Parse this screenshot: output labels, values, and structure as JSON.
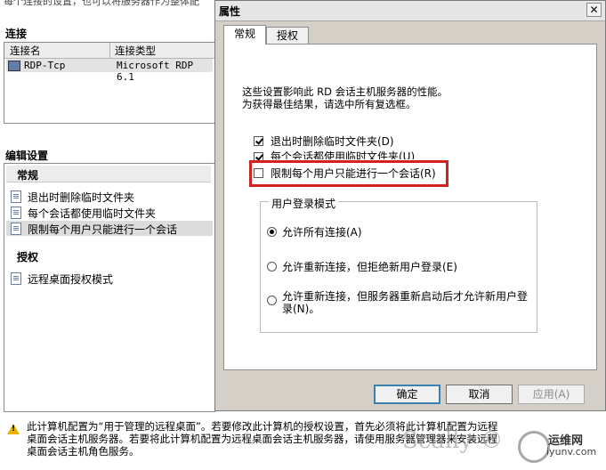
{
  "background": {
    "top_text": "每个连接的设置，也可以将服务器作为整体配",
    "connections_title": "连接",
    "columns": [
      "连接名",
      "连接类型"
    ],
    "rows": [
      {
        "name": "RDP-Tcp",
        "type": "Microsoft RDP 6.1"
      }
    ],
    "edit_title": "编辑设置",
    "groups": [
      {
        "label": "常规",
        "items": [
          "退出时删除临时文件夹",
          "每个会话都使用临时文件夹",
          "限制每个用户只能进行一个会话"
        ]
      },
      {
        "label": "授权",
        "items": [
          "远程桌面授权模式"
        ]
      }
    ],
    "bottom_note": "此计算机配置为“用于管理的远程桌面”。若要修改此计算机的授权设置，首先必须将此计算机配置为远程桌面会话主机服务器。若要将此计算机配置为远程桌面会话主机服务器，请使用服务器管理器来安装远程桌面会话主机角色服务。"
  },
  "dialog": {
    "title": "属性",
    "close_glyph": "✕",
    "tabs": [
      "常规",
      "授权"
    ],
    "description": [
      "这些设置影响此 RD 会话主机服务器的性能。",
      "为获得最佳结果，请选中所有复选框。"
    ],
    "checkboxes": [
      {
        "label": "退出时删除临时文件夹(D)",
        "checked": true
      },
      {
        "label": "每个会话都使用临时文件夹(U)",
        "checked": true
      },
      {
        "label": "限制每个用户只能进行一个会话(R)",
        "checked": false
      }
    ],
    "login_mode": {
      "legend": "用户登录模式",
      "options": [
        {
          "label": "允许所有连接(A)",
          "selected": true
        },
        {
          "label": "允许重新连接，但拒绝新用户登录(E)",
          "selected": false
        },
        {
          "label_line1": "允许重新连接，但服务器重新启动后才允许新用户登",
          "label_line2": "录(N)。",
          "selected": false
        }
      ]
    },
    "buttons": {
      "ok": "确定",
      "cancel": "取消",
      "apply": "应用(A)"
    },
    "highlight_color": "#d12121"
  },
  "watermark": {
    "text": "Scally ©",
    "brand": "运维网",
    "url": "iyunv.com"
  }
}
